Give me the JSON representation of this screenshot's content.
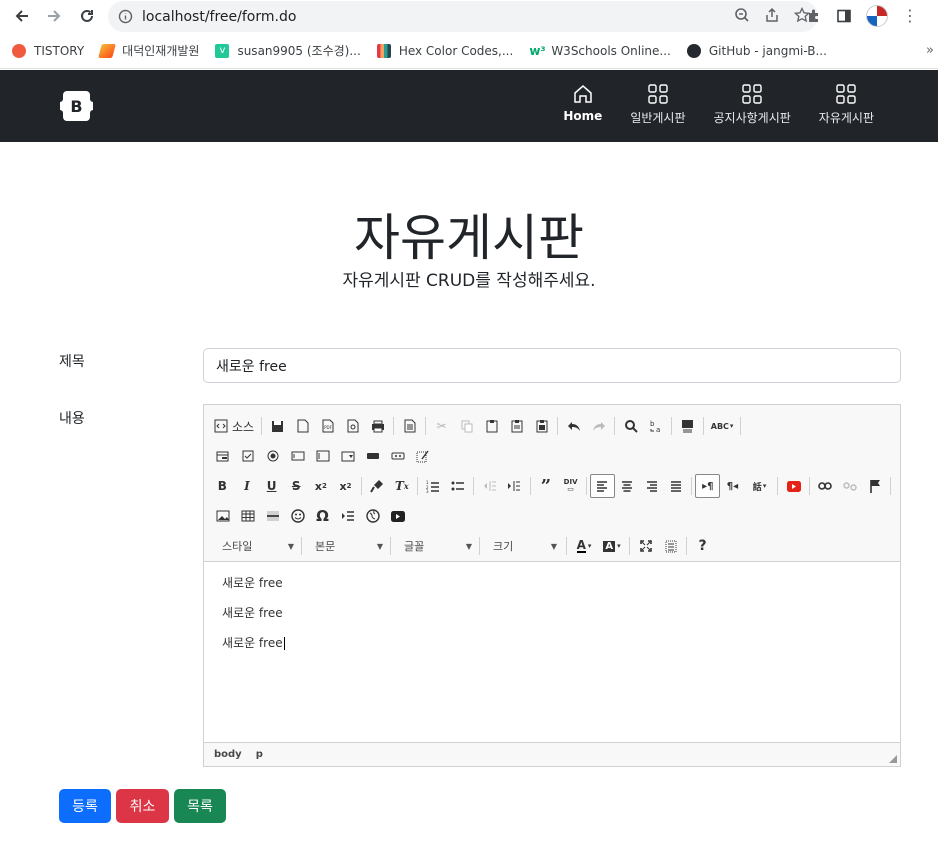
{
  "browser": {
    "url": "localhost/free/form.do",
    "bookmarks": [
      {
        "label": "TISTORY",
        "color": "#f25a40"
      },
      {
        "label": "대덕인재개발원",
        "color": "#f0a030"
      },
      {
        "label": "susan9905 (조수경)...",
        "color": "#20c997"
      },
      {
        "label": "Hex Color Codes,...",
        "color": "#e63946"
      },
      {
        "label": "W3Schools Online...",
        "color": "#04aa6d"
      },
      {
        "label": "GitHub - jangmi-B...",
        "color": "#24292f"
      }
    ],
    "more": "»"
  },
  "navbar": {
    "brand": "B",
    "items": [
      {
        "label": "Home",
        "icon": "house-icon"
      },
      {
        "label": "일반게시판",
        "icon": "grid-icon"
      },
      {
        "label": "공지사항게시판",
        "icon": "grid-icon"
      },
      {
        "label": "자유게시판",
        "icon": "grid-icon"
      }
    ]
  },
  "header": {
    "title": "자유게시판",
    "subtitle": "자유게시판 CRUD를 작성해주세요."
  },
  "form": {
    "title_label": "제목",
    "title_value": "새로운 free",
    "content_label": "내용",
    "editor": {
      "source_label": "소스",
      "style_combo": "스타일",
      "format_combo": "본문",
      "font_combo": "글꼴",
      "size_combo": "크기",
      "paragraphs": [
        "새로운 free",
        "새로운 free",
        "새로운 free"
      ],
      "path": [
        "body",
        "p"
      ]
    },
    "buttons": {
      "submit": "등록",
      "cancel": "취소",
      "list": "목록"
    }
  },
  "colors": {
    "navbar_bg": "#212529",
    "primary": "#0d6efd",
    "danger": "#dc3545",
    "success": "#198754"
  }
}
